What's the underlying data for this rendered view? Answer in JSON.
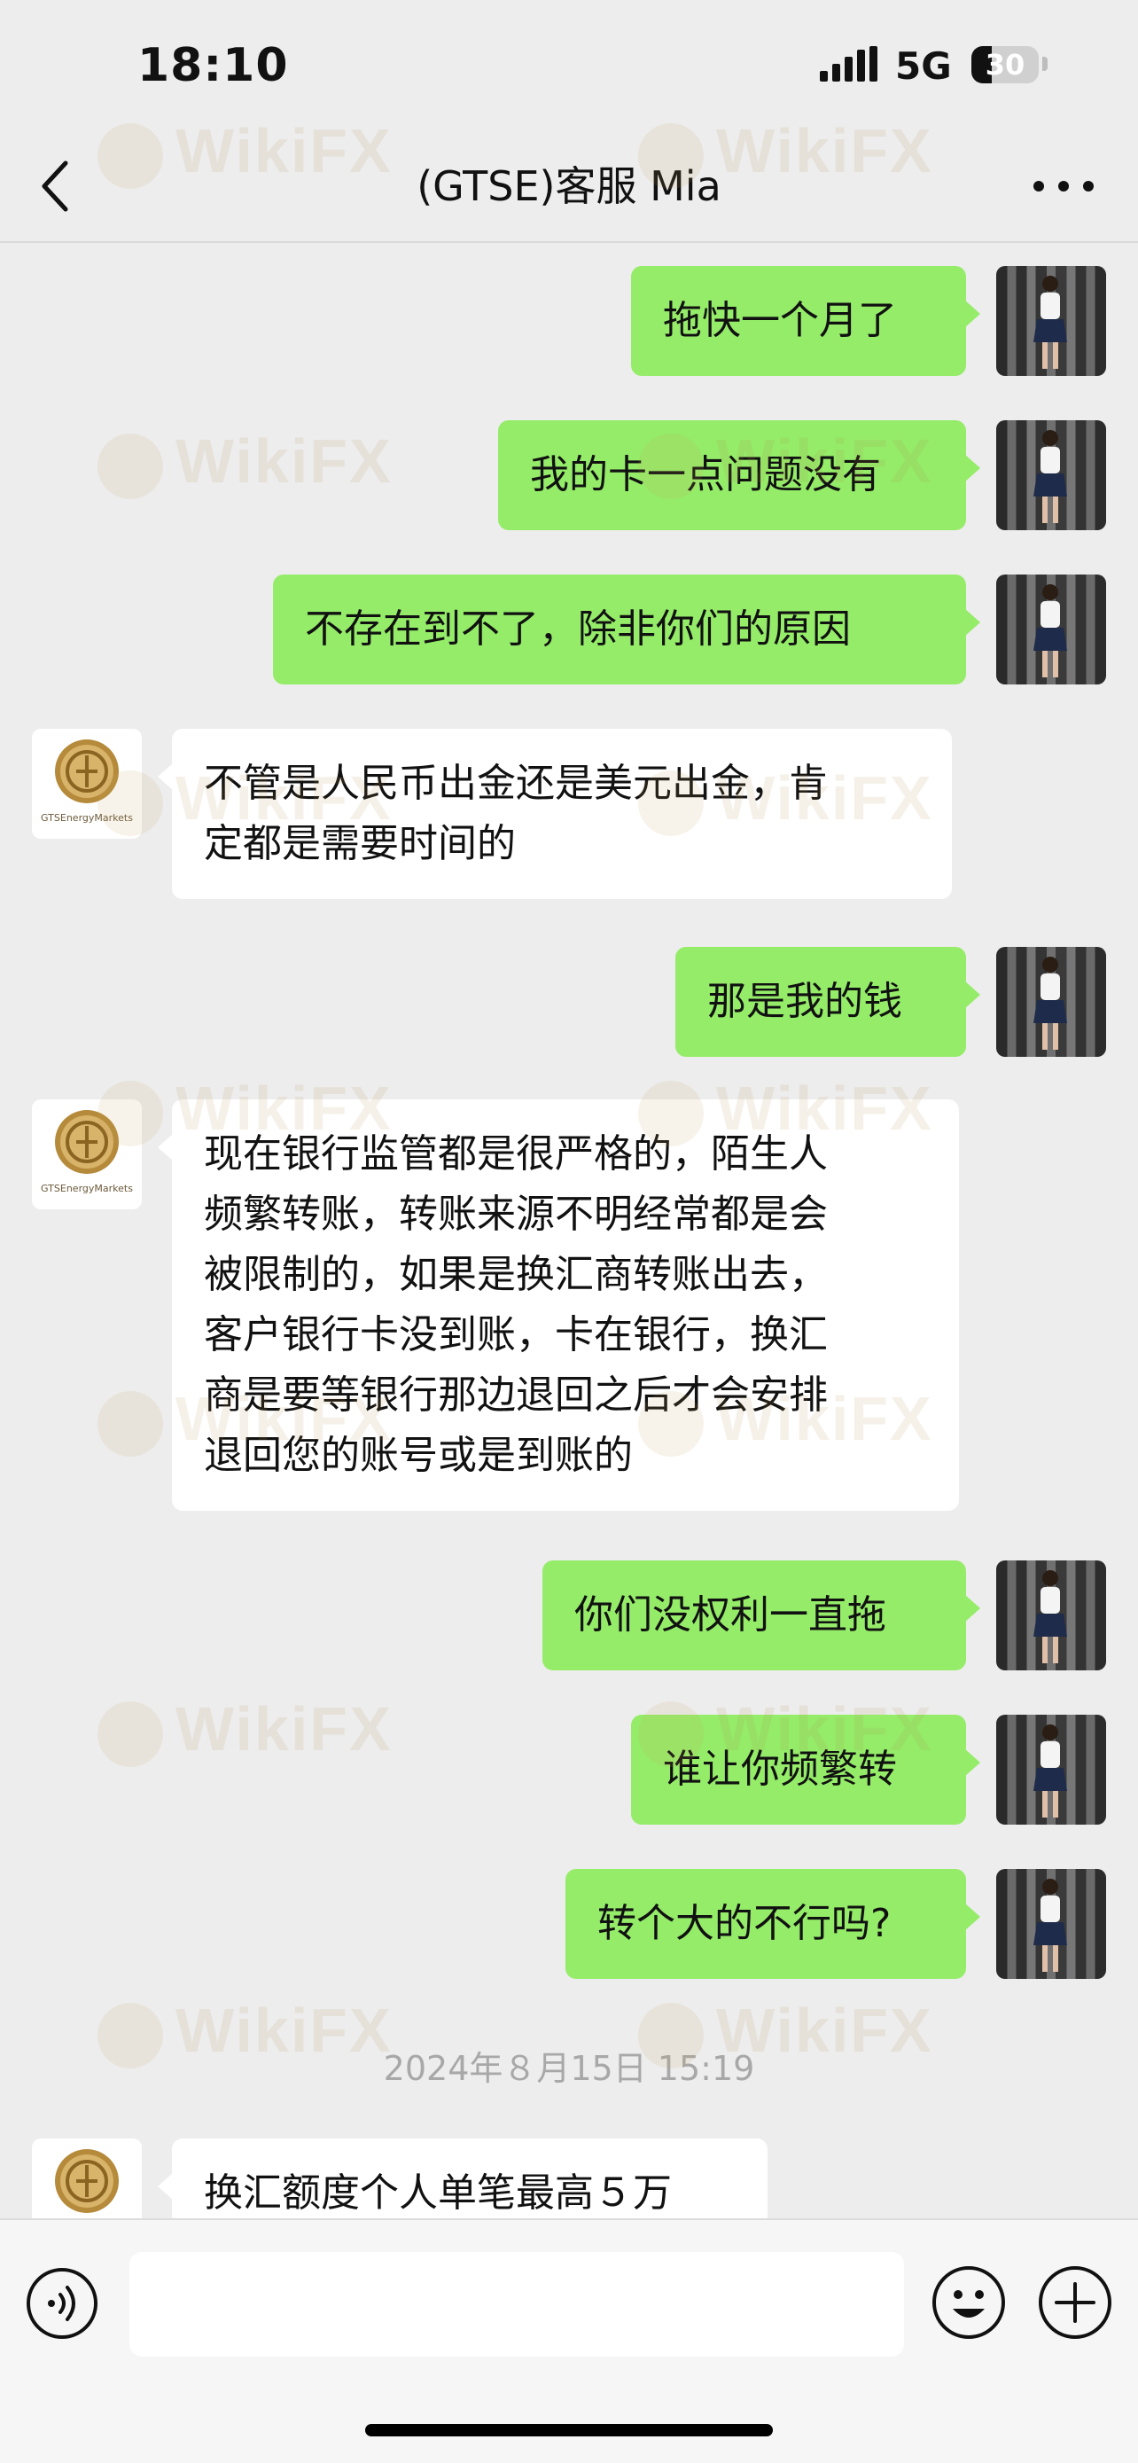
{
  "status_bar": {
    "time": "18:10",
    "network": "5G",
    "battery_level": "30"
  },
  "header": {
    "title": "(GTSE)客服  Mia"
  },
  "contact": {
    "avatar_brand": "GTSEnergyMarkets"
  },
  "messages": [
    {
      "sender": "me",
      "text": "拖快一个月了"
    },
    {
      "sender": "me",
      "text": "我的卡一点问题没有"
    },
    {
      "sender": "me",
      "text": "不存在到不了，除非你们的原因"
    },
    {
      "sender": "contact",
      "text": "不管是人民币出金还是美元出金，肯\n定都是需要时间的"
    },
    {
      "sender": "me",
      "text": "那是我的钱"
    },
    {
      "sender": "contact",
      "text": "现在银行监管都是很严格的，陌生人\n频繁转账，转账来源不明经常都是会\n被限制的，如果是换汇商转账出去，\n客户银行卡没到账，卡在银行，换汇\n商是要等银行那边退回之后才会安排\n退回您的账号或是到账的"
    },
    {
      "sender": "me",
      "text": "你们没权利一直拖"
    },
    {
      "sender": "me",
      "text": "谁让你频繁转"
    },
    {
      "sender": "me",
      "text": "转个大的不行吗?"
    },
    {
      "sender": "contact",
      "text": "换汇额度个人单笔最高５万"
    }
  ],
  "timestamp": "2024年８月15日 15:19",
  "input": {
    "placeholder": ""
  },
  "watermark": {
    "text": "WikiFX"
  },
  "colors": {
    "my_bubble": "#95ec69",
    "contact_bubble": "#ffffff",
    "background": "#ededed"
  }
}
